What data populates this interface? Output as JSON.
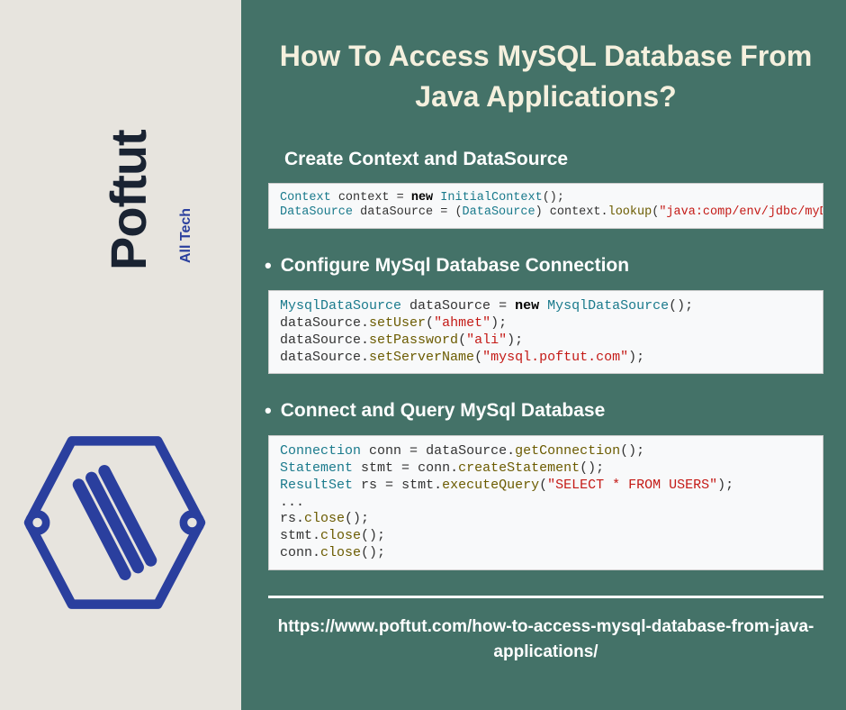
{
  "sidebar": {
    "brand": "Poftut",
    "tagline": "All Tech"
  },
  "title": "How To Access MySQL Database From Java Applications?",
  "sections": [
    {
      "heading": "Create Context and DataSource",
      "bullet": false,
      "code_tokens": [
        [
          {
            "t": "type",
            "v": "Context"
          },
          {
            "t": "punc",
            "v": " "
          },
          {
            "t": "var",
            "v": "context"
          },
          {
            "t": "punc",
            "v": " = "
          },
          {
            "t": "keyword",
            "v": "new"
          },
          {
            "t": "punc",
            "v": " "
          },
          {
            "t": "type",
            "v": "InitialContext"
          },
          {
            "t": "punc",
            "v": "();"
          }
        ],
        [
          {
            "t": "type",
            "v": "DataSource"
          },
          {
            "t": "punc",
            "v": " "
          },
          {
            "t": "var",
            "v": "dataSource"
          },
          {
            "t": "punc",
            "v": " = ("
          },
          {
            "t": "type",
            "v": "DataSource"
          },
          {
            "t": "punc",
            "v": ") "
          },
          {
            "t": "var",
            "v": "context"
          },
          {
            "t": "punc",
            "v": "."
          },
          {
            "t": "method",
            "v": "lookup"
          },
          {
            "t": "punc",
            "v": "("
          },
          {
            "t": "string",
            "v": "\"java:comp/env/jdbc/myDB\""
          },
          {
            "t": "punc",
            "v": ");"
          }
        ]
      ]
    },
    {
      "heading": "Configure MySql Database Connection",
      "bullet": true,
      "code_tokens": [
        [
          {
            "t": "type",
            "v": "MysqlDataSource"
          },
          {
            "t": "punc",
            "v": " "
          },
          {
            "t": "var",
            "v": "dataSource"
          },
          {
            "t": "punc",
            "v": " = "
          },
          {
            "t": "keyword",
            "v": "new"
          },
          {
            "t": "punc",
            "v": " "
          },
          {
            "t": "type",
            "v": "MysqlDataSource"
          },
          {
            "t": "punc",
            "v": "();"
          }
        ],
        [
          {
            "t": "var",
            "v": "dataSource"
          },
          {
            "t": "punc",
            "v": "."
          },
          {
            "t": "method",
            "v": "setUser"
          },
          {
            "t": "punc",
            "v": "("
          },
          {
            "t": "string",
            "v": "\"ahmet\""
          },
          {
            "t": "punc",
            "v": ");"
          }
        ],
        [
          {
            "t": "var",
            "v": "dataSource"
          },
          {
            "t": "punc",
            "v": "."
          },
          {
            "t": "method",
            "v": "setPassword"
          },
          {
            "t": "punc",
            "v": "("
          },
          {
            "t": "string",
            "v": "\"ali\""
          },
          {
            "t": "punc",
            "v": ");"
          }
        ],
        [
          {
            "t": "var",
            "v": "dataSource"
          },
          {
            "t": "punc",
            "v": "."
          },
          {
            "t": "method",
            "v": "setServerName"
          },
          {
            "t": "punc",
            "v": "("
          },
          {
            "t": "string",
            "v": "\"mysql.poftut.com\""
          },
          {
            "t": "punc",
            "v": ");"
          }
        ]
      ]
    },
    {
      "heading": "Connect and Query MySql Database",
      "bullet": true,
      "code_tokens": [
        [
          {
            "t": "type",
            "v": "Connection"
          },
          {
            "t": "punc",
            "v": " "
          },
          {
            "t": "var",
            "v": "conn"
          },
          {
            "t": "punc",
            "v": " = "
          },
          {
            "t": "var",
            "v": "dataSource"
          },
          {
            "t": "punc",
            "v": "."
          },
          {
            "t": "method",
            "v": "getConnection"
          },
          {
            "t": "punc",
            "v": "();"
          }
        ],
        [
          {
            "t": "type",
            "v": "Statement"
          },
          {
            "t": "punc",
            "v": " "
          },
          {
            "t": "var",
            "v": "stmt"
          },
          {
            "t": "punc",
            "v": " = "
          },
          {
            "t": "var",
            "v": "conn"
          },
          {
            "t": "punc",
            "v": "."
          },
          {
            "t": "method",
            "v": "createStatement"
          },
          {
            "t": "punc",
            "v": "();"
          }
        ],
        [
          {
            "t": "type",
            "v": "ResultSet"
          },
          {
            "t": "punc",
            "v": " "
          },
          {
            "t": "var",
            "v": "rs"
          },
          {
            "t": "punc",
            "v": " = "
          },
          {
            "t": "var",
            "v": "stmt"
          },
          {
            "t": "punc",
            "v": "."
          },
          {
            "t": "method",
            "v": "executeQuery"
          },
          {
            "t": "punc",
            "v": "("
          },
          {
            "t": "string",
            "v": "\"SELECT * FROM USERS\""
          },
          {
            "t": "punc",
            "v": ");"
          }
        ],
        [
          {
            "t": "punc",
            "v": "..."
          }
        ],
        [
          {
            "t": "var",
            "v": "rs"
          },
          {
            "t": "punc",
            "v": "."
          },
          {
            "t": "method",
            "v": "close"
          },
          {
            "t": "punc",
            "v": "();"
          }
        ],
        [
          {
            "t": "var",
            "v": "stmt"
          },
          {
            "t": "punc",
            "v": "."
          },
          {
            "t": "method",
            "v": "close"
          },
          {
            "t": "punc",
            "v": "();"
          }
        ],
        [
          {
            "t": "var",
            "v": "conn"
          },
          {
            "t": "punc",
            "v": "."
          },
          {
            "t": "method",
            "v": "close"
          },
          {
            "t": "punc",
            "v": "();"
          }
        ]
      ]
    }
  ],
  "footer_url": "https://www.poftut.com/how-to-access-mysql-database-from-java-applications/"
}
